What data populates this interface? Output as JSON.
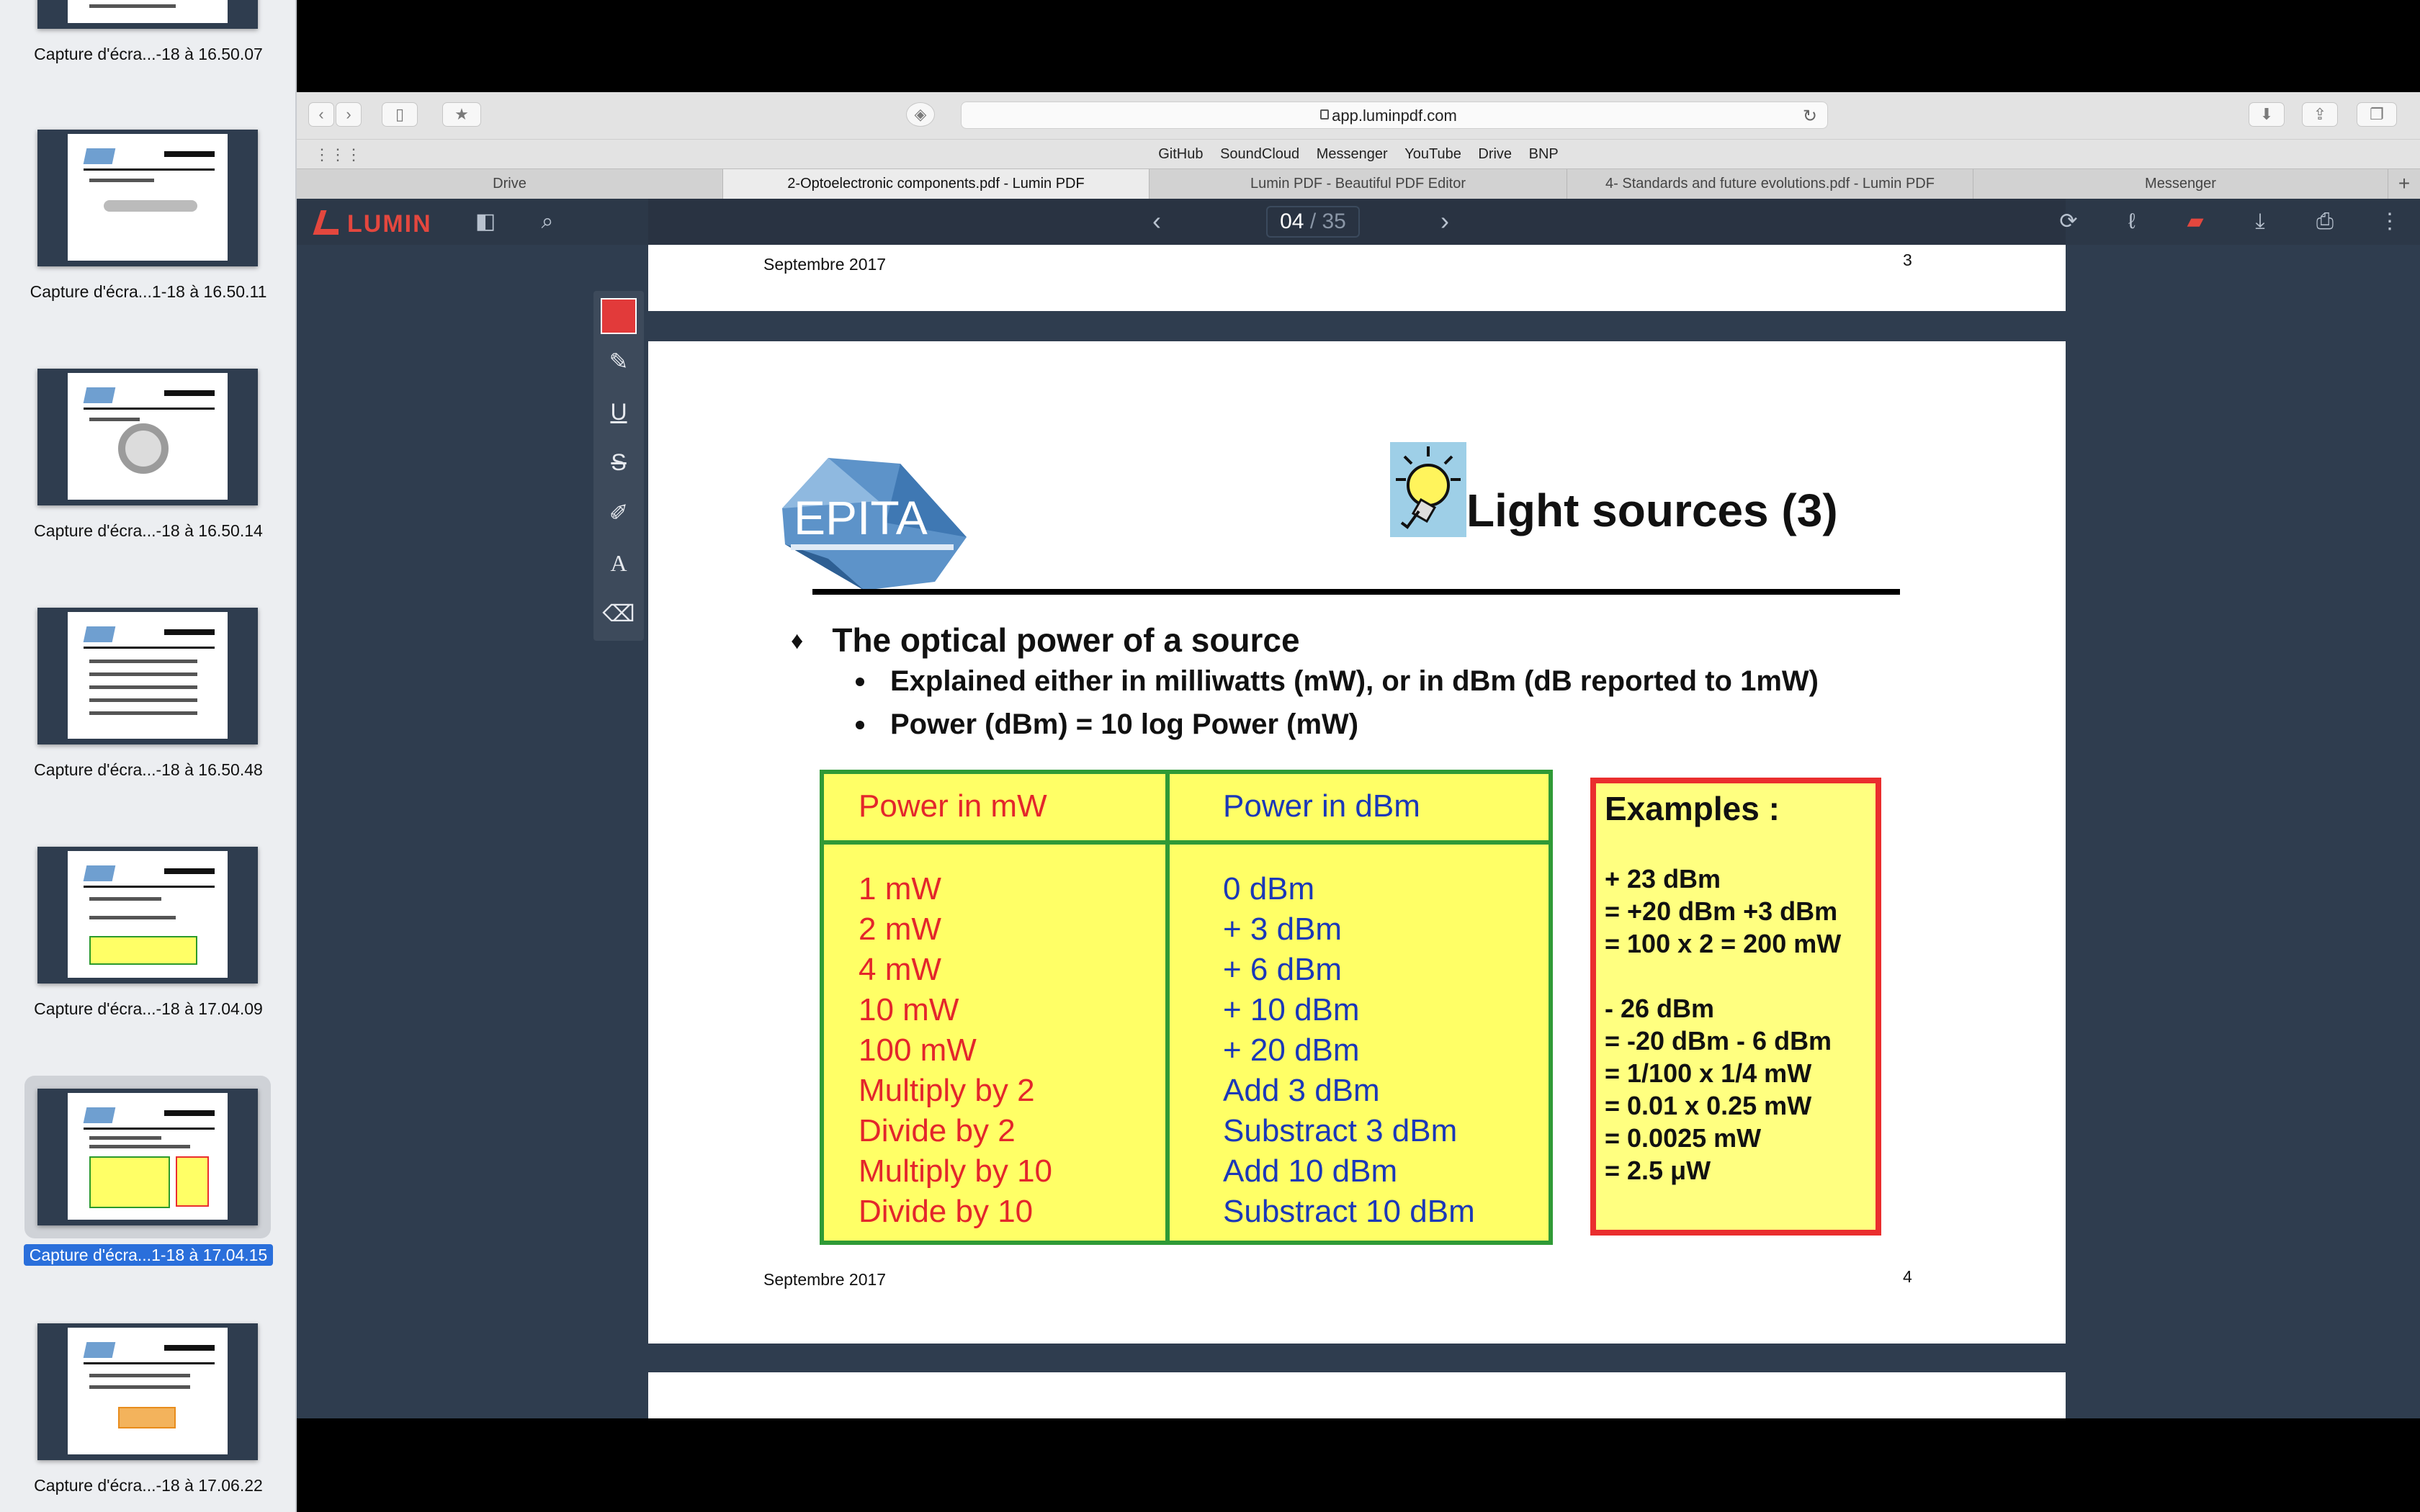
{
  "thumbnails": [
    {
      "caption": "Capture d'écra...-18 à 16.50.07",
      "selected": false
    },
    {
      "caption": "Capture d'écra...1-18 à 16.50.11",
      "selected": false
    },
    {
      "caption": "Capture d'écra...-18 à 16.50.14",
      "selected": false
    },
    {
      "caption": "Capture d'écra...-18 à 16.50.48",
      "selected": false
    },
    {
      "caption": "Capture d'écra...-18 à 17.04.09",
      "selected": false
    },
    {
      "caption": "Capture d'écra...1-18 à 17.04.15",
      "selected": true
    },
    {
      "caption": "Capture d'écra...-18 à 17.06.22",
      "selected": false
    }
  ],
  "browser": {
    "url": "app.luminpdf.com",
    "favorites": [
      "GitHub",
      "SoundCloud",
      "Messenger",
      "YouTube",
      "Drive",
      "BNP"
    ],
    "tabs": [
      {
        "label": "Drive",
        "active": false
      },
      {
        "label": "2-Optoelectronic components.pdf - Lumin PDF",
        "active": true
      },
      {
        "label": "Lumin PDF - Beautiful PDF Editor",
        "active": false
      },
      {
        "label": "4- Standards and future evolutions.pdf - Lumin PDF",
        "active": false
      },
      {
        "label": "Messenger",
        "active": false
      }
    ],
    "new_tab": "+"
  },
  "lumin": {
    "brand": "LUMIN",
    "current_page": "04",
    "total_pages": "/ 35",
    "annotation_color": "#e23a3a",
    "tools": [
      "pen-icon",
      "underline-icon",
      "strikethrough-icon",
      "highlighter-icon",
      "text-icon",
      "eraser-icon"
    ]
  },
  "prev_page": {
    "footer_left": "Septembre 2017",
    "footer_right": "3"
  },
  "slide": {
    "logo_text": "EPITA",
    "title": "Light sources (3)",
    "bullet": "The optical power of a source",
    "sub_bullets": [
      "Explained either in milliwatts (mW), or in dBm (dB reported to 1mW)",
      "Power (dBm) = 10 log Power (mW)"
    ],
    "table": {
      "header_left": "Power in mW",
      "header_right": "Power in dBm",
      "rows": [
        [
          "1 mW",
          "0 dBm"
        ],
        [
          "2 mW",
          "+ 3 dBm"
        ],
        [
          "4 mW",
          "+ 6 dBm"
        ],
        [
          "10 mW",
          "+ 10 dBm"
        ],
        [
          "100 mW",
          "+ 20 dBm"
        ],
        [
          "Multiply by 2",
          "Add 3 dBm"
        ],
        [
          "Divide by 2",
          "Substract 3 dBm"
        ],
        [
          "Multiply by 10",
          "Add 10 dBm"
        ],
        [
          "Divide by 10",
          "Substract 10 dBm"
        ]
      ]
    },
    "examples": {
      "heading": "Examples :",
      "lines": [
        "+ 23 dBm",
        "= +20 dBm +3 dBm",
        "= 100 x 2 = 200 mW",
        "",
        "- 26 dBm",
        "= -20 dBm - 6 dBm",
        "= 1/100 x 1/4 mW",
        "= 0.01 x 0.25 mW",
        "= 0.0025 mW",
        "= 2.5 μW"
      ]
    },
    "footer_left": "Septembre 2017",
    "footer_right": "4"
  }
}
